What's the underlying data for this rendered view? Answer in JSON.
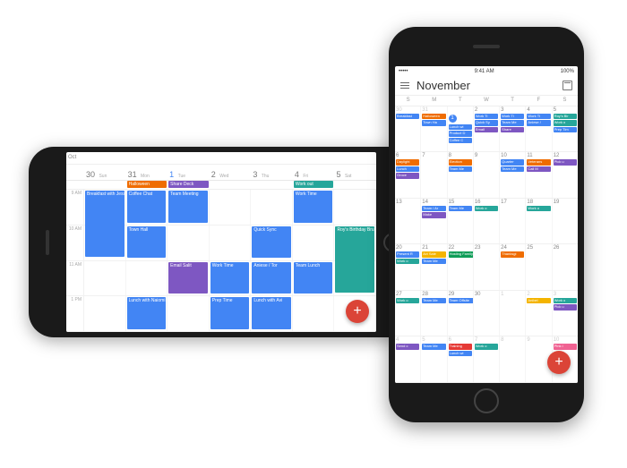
{
  "statusbar": {
    "time": "9:41 AM",
    "battery": "100%",
    "carrier": "•••••"
  },
  "landscape": {
    "month": "Oct",
    "days": [
      {
        "num": "30",
        "label": "Sun"
      },
      {
        "num": "31",
        "label": "Mon"
      },
      {
        "num": "1",
        "label": "Tue",
        "today": true
      },
      {
        "num": "2",
        "label": "Wed"
      },
      {
        "num": "3",
        "label": "Thu"
      },
      {
        "num": "4",
        "label": "Fri"
      },
      {
        "num": "5",
        "label": "Sat"
      }
    ],
    "allday": [
      {
        "col": 1,
        "label": "Halloween",
        "color": "c-or"
      },
      {
        "col": 2,
        "label": "Share Deck",
        "color": "c-pu"
      },
      {
        "col": 5,
        "label": "Work out",
        "color": "c-te"
      }
    ],
    "hours": [
      "9 AM",
      "10 AM",
      "11 AM",
      "1 PM"
    ],
    "events": [
      {
        "col": 0,
        "row": 0,
        "h": 2,
        "label": "Breakfast with Jess",
        "color": "c-bl"
      },
      {
        "col": 1,
        "row": 0,
        "h": 1,
        "label": "Coffee Chat",
        "color": "c-bl"
      },
      {
        "col": 1,
        "row": 1,
        "h": 1,
        "label": "Town Hall",
        "color": "c-bl"
      },
      {
        "col": 1,
        "row": 3,
        "h": 1,
        "label": "Lunch with Naiomi",
        "color": "c-bl"
      },
      {
        "col": 2,
        "row": 0,
        "h": 1,
        "label": "Team Meeting",
        "color": "c-bl"
      },
      {
        "col": 2,
        "row": 2,
        "h": 1,
        "label": "Email Salit",
        "color": "c-pu"
      },
      {
        "col": 3,
        "row": 2,
        "h": 1,
        "label": "Work Time",
        "color": "c-bl"
      },
      {
        "col": 3,
        "row": 3,
        "h": 1,
        "label": "Prep Time",
        "color": "c-bl"
      },
      {
        "col": 4,
        "row": 1,
        "h": 1,
        "label": "Quick Sync",
        "color": "c-bl"
      },
      {
        "col": 4,
        "row": 2,
        "h": 1,
        "label": "Aniese / Tor",
        "color": "c-bl"
      },
      {
        "col": 4,
        "row": 3,
        "h": 1,
        "label": "Lunch with Avi",
        "color": "c-bl"
      },
      {
        "col": 5,
        "row": 0,
        "h": 1,
        "label": "Work Time",
        "color": "c-bl"
      },
      {
        "col": 5,
        "row": 2,
        "h": 1,
        "label": "Team Lunch",
        "color": "c-bl"
      },
      {
        "col": 6,
        "row": 1,
        "h": 2,
        "label": "Roy's Birthday Brunch",
        "color": "c-te"
      }
    ],
    "fab": "+"
  },
  "portrait": {
    "month": "November",
    "weekdays": [
      "S",
      "M",
      "T",
      "W",
      "T",
      "F",
      "S"
    ],
    "fab": "+",
    "weeks": [
      [
        {
          "n": "30",
          "dim": true,
          "ev": [
            {
              "l": "Breakfast",
              "c": "c-bl"
            }
          ]
        },
        {
          "n": "31",
          "dim": true,
          "ev": [
            {
              "l": "Halloween",
              "c": "c-or"
            },
            {
              "l": "Town Ha",
              "c": "c-bl"
            }
          ]
        },
        {
          "n": "1",
          "today": true,
          "ev": [
            {
              "l": "Lunch wi",
              "c": "c-bl"
            },
            {
              "l": "Product D",
              "c": "c-bl"
            },
            {
              "l": "Coffee C",
              "c": "c-bl"
            }
          ]
        },
        {
          "n": "2",
          "ev": [
            {
              "l": "Work Ti",
              "c": "c-bl"
            },
            {
              "l": "Quick Sy",
              "c": "c-bl"
            },
            {
              "l": "Email",
              "c": "c-pu"
            }
          ]
        },
        {
          "n": "3",
          "ev": [
            {
              "l": "Work Ti",
              "c": "c-bl"
            },
            {
              "l": "Team Me",
              "c": "c-bl"
            },
            {
              "l": "Share",
              "c": "c-pu"
            }
          ]
        },
        {
          "n": "4",
          "ev": [
            {
              "l": "Work Ti",
              "c": "c-bl"
            },
            {
              "l": "Aniese /",
              "c": "c-bl"
            }
          ]
        },
        {
          "n": "5",
          "ev": [
            {
              "l": "Roy's Bir",
              "c": "c-te"
            },
            {
              "l": "Work o",
              "c": "c-te"
            },
            {
              "l": "Prep Tim",
              "c": "c-bl"
            }
          ]
        }
      ],
      [
        {
          "n": "6",
          "ev": [
            {
              "l": "Daylight",
              "c": "c-or"
            },
            {
              "l": "Lunch",
              "c": "c-bl"
            },
            {
              "l": "Groce",
              "c": "c-pu"
            }
          ]
        },
        {
          "n": "7",
          "ev": []
        },
        {
          "n": "8",
          "ev": [
            {
              "l": "Election",
              "c": "c-or"
            },
            {
              "l": "Team Me",
              "c": "c-bl"
            }
          ]
        },
        {
          "n": "9",
          "ev": []
        },
        {
          "n": "10",
          "ev": [
            {
              "l": "Quarter",
              "c": "c-bl"
            },
            {
              "l": "Team Me",
              "c": "c-bl"
            }
          ]
        },
        {
          "n": "11",
          "ev": [
            {
              "l": "Veterans",
              "c": "c-or"
            },
            {
              "l": "Call M",
              "c": "c-pu"
            }
          ]
        },
        {
          "n": "12",
          "ev": [
            {
              "l": "Pick u",
              "c": "c-pu"
            }
          ]
        }
      ],
      [
        {
          "n": "13",
          "ev": []
        },
        {
          "n": "14",
          "ev": [
            {
              "l": "Team / Ar",
              "c": "c-bl"
            },
            {
              "l": "Make",
              "c": "c-pu"
            }
          ]
        },
        {
          "n": "15",
          "ev": [
            {
              "l": "Team Me",
              "c": "c-bl"
            }
          ]
        },
        {
          "n": "16",
          "ev": [
            {
              "l": "Work o",
              "c": "c-te"
            }
          ]
        },
        {
          "n": "17",
          "ev": []
        },
        {
          "n": "18",
          "ev": [
            {
              "l": "Work o",
              "c": "c-te"
            }
          ]
        },
        {
          "n": "19",
          "ev": []
        }
      ],
      [
        {
          "n": "20",
          "ev": [
            {
              "l": "Present R",
              "c": "c-bl"
            },
            {
              "l": "Work o",
              "c": "c-te"
            }
          ]
        },
        {
          "n": "21",
          "ev": [
            {
              "l": "Avi Sale",
              "c": "c-ye"
            },
            {
              "l": "Team Me",
              "c": "c-bl"
            }
          ]
        },
        {
          "n": "22",
          "ev": [
            {
              "l": "Hosting Family for Thanksgiving",
              "c": "c-gr",
              "span": 5
            }
          ]
        },
        {
          "n": "23",
          "ev": []
        },
        {
          "n": "24",
          "ev": [
            {
              "l": "Thanksgi",
              "c": "c-or"
            }
          ]
        },
        {
          "n": "25",
          "ev": []
        },
        {
          "n": "26",
          "ev": []
        }
      ],
      [
        {
          "n": "27",
          "ev": [
            {
              "l": "Work o",
              "c": "c-te"
            }
          ]
        },
        {
          "n": "28",
          "ev": [
            {
              "l": "Team Me",
              "c": "c-bl"
            }
          ]
        },
        {
          "n": "29",
          "ev": [
            {
              "l": "Team Offsite",
              "c": "c-bl",
              "span": 2
            }
          ]
        },
        {
          "n": "30",
          "ev": []
        },
        {
          "n": "1",
          "dim": true,
          "ev": []
        },
        {
          "n": "2",
          "dim": true,
          "ev": [
            {
              "l": "Anibel",
              "c": "c-ye"
            }
          ]
        },
        {
          "n": "3",
          "dim": true,
          "ev": [
            {
              "l": "Work o",
              "c": "c-te"
            },
            {
              "l": "Pick u",
              "c": "c-pu"
            }
          ]
        }
      ],
      [
        {
          "n": "4",
          "dim": true,
          "ev": [
            {
              "l": "Send c",
              "c": "c-pu"
            }
          ]
        },
        {
          "n": "5",
          "dim": true,
          "ev": [
            {
              "l": "Team Me",
              "c": "c-bl"
            }
          ]
        },
        {
          "n": "6",
          "dim": true,
          "ev": [
            {
              "l": "Training",
              "c": "c-rd"
            },
            {
              "l": "Lunch wi",
              "c": "c-bl"
            }
          ]
        },
        {
          "n": "7",
          "dim": true,
          "ev": [
            {
              "l": "Work o",
              "c": "c-te"
            }
          ]
        },
        {
          "n": "8",
          "dim": true,
          "ev": []
        },
        {
          "n": "9",
          "dim": true,
          "ev": []
        },
        {
          "n": "10",
          "dim": true,
          "ev": [
            {
              "l": "Pink i",
              "c": "c-pk"
            }
          ]
        }
      ]
    ]
  }
}
